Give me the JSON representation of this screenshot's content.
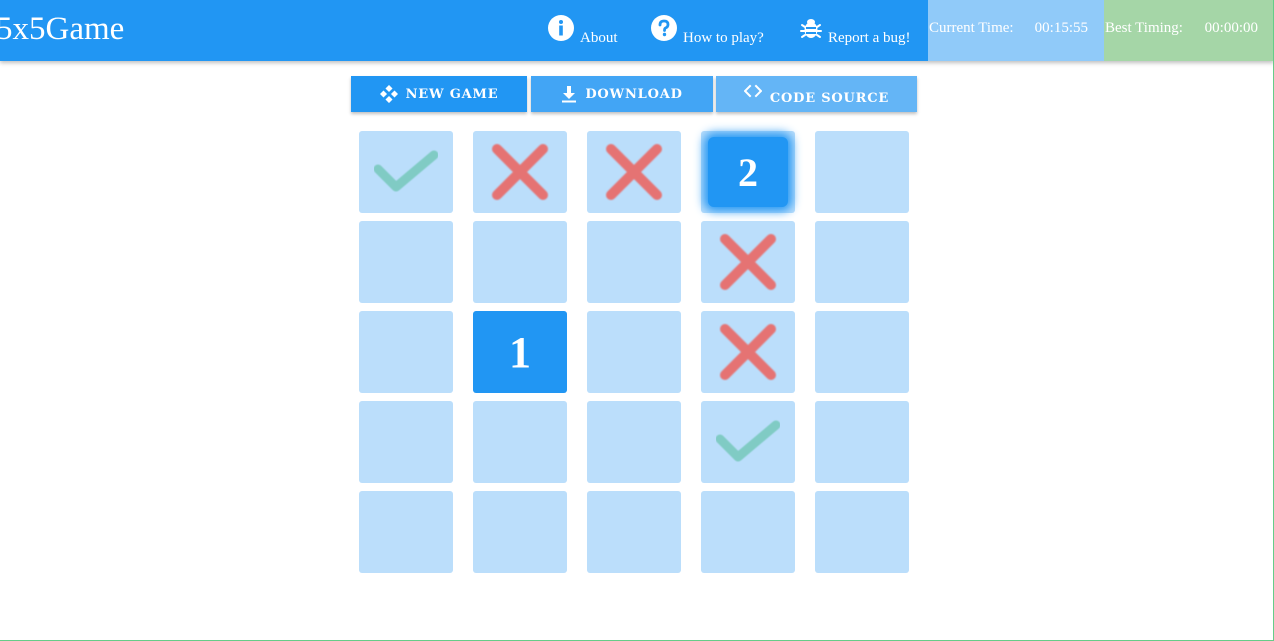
{
  "app": {
    "title": "5x5Game"
  },
  "nav": [
    {
      "label": "About",
      "icon": "info-icon"
    },
    {
      "label": "How to play?",
      "icon": "help-icon"
    },
    {
      "label": "Report a bug!",
      "icon": "bug-icon"
    }
  ],
  "timers": {
    "current_label": "Current Time:",
    "current_value": "00:15:55",
    "best_label": "Best Timing:",
    "best_value": "00:00:00"
  },
  "toolbar": {
    "new_game": "NEW GAME",
    "download": "DOWNLOAD",
    "code_source": "CODE SOURCE"
  },
  "board": {
    "rows": [
      [
        {
          "state": "check"
        },
        {
          "state": "cross"
        },
        {
          "state": "cross"
        },
        {
          "state": "current",
          "value": "2"
        },
        {
          "state": "empty"
        }
      ],
      [
        {
          "state": "empty"
        },
        {
          "state": "empty"
        },
        {
          "state": "empty"
        },
        {
          "state": "cross"
        },
        {
          "state": "empty"
        }
      ],
      [
        {
          "state": "empty"
        },
        {
          "state": "number",
          "value": "1"
        },
        {
          "state": "empty"
        },
        {
          "state": "cross"
        },
        {
          "state": "empty"
        }
      ],
      [
        {
          "state": "empty"
        },
        {
          "state": "empty"
        },
        {
          "state": "empty"
        },
        {
          "state": "check"
        },
        {
          "state": "empty"
        }
      ],
      [
        {
          "state": "empty"
        },
        {
          "state": "empty"
        },
        {
          "state": "empty"
        },
        {
          "state": "empty"
        },
        {
          "state": "empty"
        }
      ]
    ]
  },
  "colors": {
    "primary": "#2196f3",
    "cell": "#bbdefb",
    "check": "#80cbc4",
    "cross": "#e57373",
    "timer_current_bg": "#90caf9",
    "timer_best_bg": "#a5d6a7"
  }
}
